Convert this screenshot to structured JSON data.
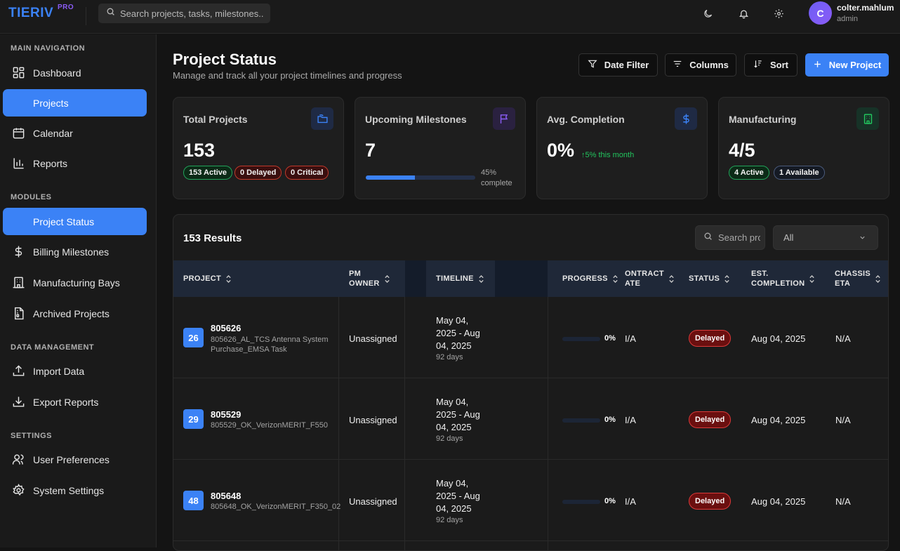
{
  "app": {
    "logo": "TIERIV",
    "logo_badge": "PRO",
    "search_placeholder": "Search projects, tasks, milestones...",
    "user": {
      "initial": "C",
      "name": "colter.mahlum",
      "role": "admin"
    },
    "toolbar_icons": [
      "moon-icon",
      "bell-icon",
      "gear-icon"
    ]
  },
  "sidebar": {
    "sections": [
      {
        "title": "MAIN NAVIGATION",
        "items": [
          {
            "label": "Dashboard",
            "icon": "dashboard-icon"
          },
          {
            "label": "Projects",
            "icon": "folder-icon",
            "active": true
          },
          {
            "label": "Calendar",
            "icon": "calendar-icon"
          },
          {
            "label": "Reports",
            "icon": "bar-chart-icon"
          }
        ]
      },
      {
        "title": "MODULES",
        "items": [
          {
            "label": "Project Status",
            "icon": "status-icon",
            "active": true
          },
          {
            "label": "Billing Milestones",
            "icon": "dollar-icon"
          },
          {
            "label": "Manufacturing Bays",
            "icon": "building-icon"
          },
          {
            "label": "Archived Projects",
            "icon": "archive-icon"
          }
        ]
      },
      {
        "title": "DATA MANAGEMENT",
        "items": [
          {
            "label": "Import Data",
            "icon": "upload-icon"
          },
          {
            "label": "Export Reports",
            "icon": "download-icon"
          }
        ]
      },
      {
        "title": "SETTINGS",
        "items": [
          {
            "label": "User Preferences",
            "icon": "users-icon"
          },
          {
            "label": "System Settings",
            "icon": "gear-icon"
          }
        ]
      }
    ]
  },
  "header": {
    "title": "Project Status",
    "subtitle": "Manage and track all your project timelines and progress",
    "buttons": {
      "date_filter": "Date Filter",
      "columns": "Columns",
      "sort": "Sort",
      "new_project": "New Project"
    }
  },
  "cards": {
    "total": {
      "title": "Total Projects",
      "value": "153",
      "active": "153 Active",
      "delayed": "0 Delayed",
      "critical": "0 Critical"
    },
    "milestones": {
      "title": "Upcoming Milestones",
      "value": "7",
      "progress": 0.45,
      "pct_label": "45%",
      "pct_suffix": "complete"
    },
    "completion": {
      "title": "Avg. Completion",
      "value": "0%",
      "trend": "5% this month"
    },
    "manufacturing": {
      "title": "Manufacturing",
      "value": "4/5",
      "active": "4 Active",
      "available": "1 Available"
    },
    "colors": {
      "blue": "#3b82f6",
      "purple": "#8b5cf6",
      "green": "#22c55e",
      "red": "#dc3a3a"
    }
  },
  "table": {
    "results": "153 Results",
    "search_placeholder": "Search projects",
    "filter_value": "All",
    "headers": {
      "project": "PROJECT",
      "pm1": "PM",
      "pm2": "OWNER",
      "timeline": "TIMELINE",
      "progress": "PROGRESS",
      "contract1": "ONTRACT",
      "contract2": "ATE",
      "status": "STATUS",
      "est1": "EST.",
      "est2": "COMPLETION",
      "chassis1": "CHASSIS",
      "chassis2": "ETA"
    },
    "rows": [
      {
        "num": "26",
        "id": "805626",
        "desc": "805626_AL_TCS Antenna System Purchase_EMSA Task",
        "owner": "Unassigned",
        "tl1": "May 04,",
        "tl2": "2025 - Aug",
        "tl3": "04, 2025",
        "days": "92 days",
        "progress": "0%",
        "progress_value": 0,
        "contract": "I/A",
        "status": "Delayed",
        "est": "Aug 04, 2025",
        "chassis": "N/A"
      },
      {
        "num": "29",
        "id": "805529",
        "desc": "805529_OK_VerizonMERIT_F550",
        "owner": "Unassigned",
        "tl1": "May 04,",
        "tl2": "2025 - Aug",
        "tl3": "04, 2025",
        "days": "92 days",
        "progress": "0%",
        "progress_value": 0,
        "contract": "I/A",
        "status": "Delayed",
        "est": "Aug 04, 2025",
        "chassis": "N/A"
      },
      {
        "num": "48",
        "id": "805648",
        "desc": "805648_OK_VerizonMERIT_F350_02",
        "owner": "Unassigned",
        "tl1": "May 04,",
        "tl2": "2025 - Aug",
        "tl3": "04, 2025",
        "days": "92 days",
        "progress": "0%",
        "progress_value": 0,
        "contract": "I/A",
        "status": "Delayed",
        "est": "Aug 04, 2025",
        "chassis": "N/A"
      }
    ]
  }
}
